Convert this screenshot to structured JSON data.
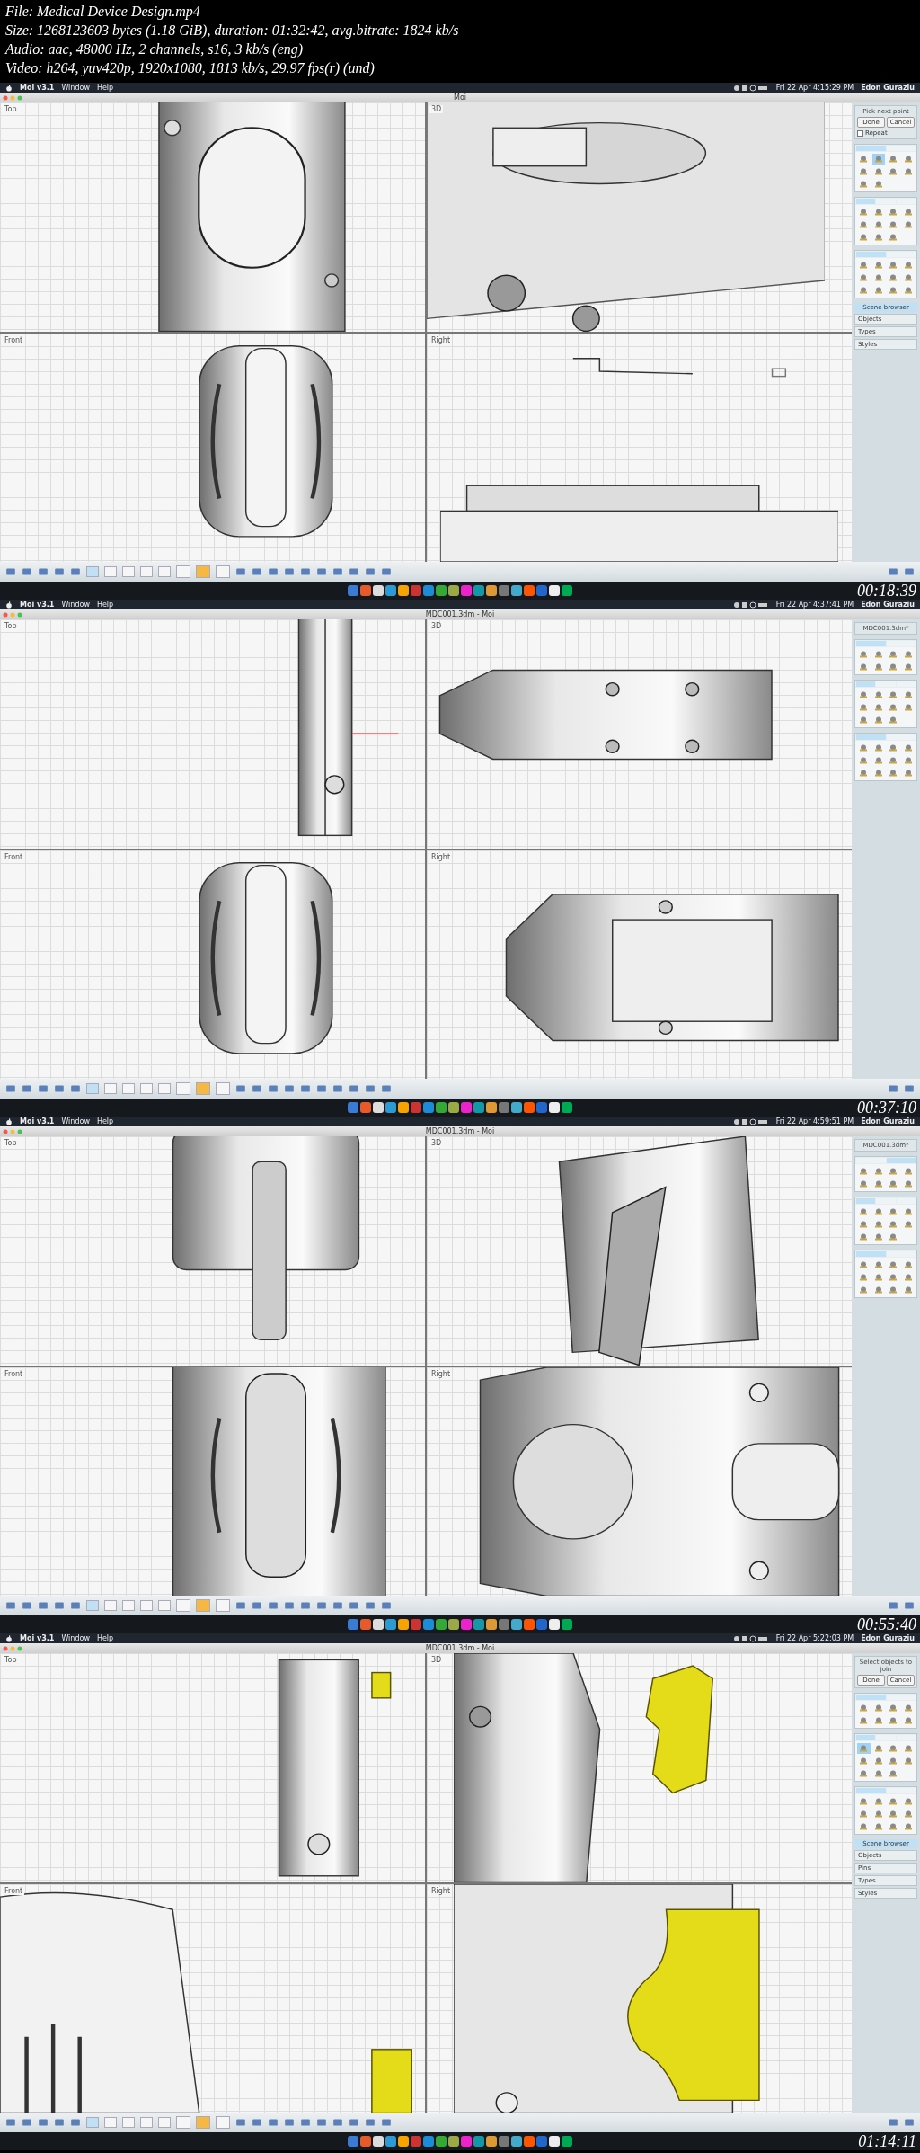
{
  "file_info": [
    "File: Medical Device Design.mp4",
    "Size: 1268123603 bytes (1.18 GiB), duration: 01:32:42, avg.bitrate: 1824 kb/s",
    "Audio: aac, 48000 Hz, 2 channels, s16, 3 kb/s (eng)",
    "Video: h264, yuv420p, 1920x1080, 1813 kb/s, 29.97 fps(r) (und)"
  ],
  "frames": [
    {
      "timestamp": "00:18:39",
      "menubar": {
        "app": "Moi v3.1",
        "menus": [
          "Window",
          "Help"
        ],
        "clock": "Fri 22 Apr 4:15:29 PM",
        "user": "Edon Guraziu"
      },
      "window_title": "Moi",
      "viewports": [
        {
          "label": "Top",
          "kind": "slot"
        },
        {
          "label": "3D",
          "kind": "disc"
        },
        {
          "label": "Front",
          "kind": "wheel"
        },
        {
          "label": "Right",
          "kind": "line"
        }
      ],
      "sidebar": {
        "prompt": "Pick next point",
        "buttons": [
          "Done",
          "Cancel"
        ],
        "repeat": {
          "label": "Repeat",
          "checked": false
        },
        "scene": {
          "title": "Scene browser",
          "items": [
            "Objects",
            "Types",
            "Styles"
          ]
        },
        "panels": [
          {
            "tabs": [
              {
                "selected": true
              },
              {
                "selected": false
              }
            ],
            "tools": [
              {
                "selected": false
              },
              {
                "selected": true
              },
              {
                "selected": false
              },
              {
                "selected": false
              },
              {
                "selected": false
              },
              {
                "selected": false
              },
              {
                "selected": false
              },
              {
                "selected": false
              },
              {
                "selected": false
              },
              {
                "selected": false
              }
            ]
          },
          {
            "tabs": [
              {
                "selected": true
              },
              {
                "selected": false
              },
              {
                "selected": false
              }
            ],
            "tools": [
              {
                "selected": false
              },
              {
                "selected": false
              },
              {
                "selected": false
              },
              {
                "selected": false
              },
              {
                "selected": false
              },
              {
                "selected": false
              },
              {
                "selected": false
              },
              {
                "selected": false
              },
              {
                "selected": false
              },
              {
                "selected": false
              },
              {
                "selected": false
              }
            ]
          },
          {
            "tabs": [
              {
                "selected": true
              },
              {
                "selected": false
              }
            ],
            "tools": [
              {
                "selected": false
              },
              {
                "selected": false
              },
              {
                "selected": false
              },
              {
                "selected": false
              },
              {
                "selected": false
              },
              {
                "selected": false
              },
              {
                "selected": false
              },
              {
                "selected": false
              },
              {
                "selected": false
              },
              {
                "selected": false
              },
              {
                "selected": false
              },
              {
                "selected": false
              }
            ]
          }
        ]
      },
      "toolbar": [
        {
          "kind": "tool"
        },
        {
          "kind": "tool"
        },
        {
          "kind": "tool"
        },
        {
          "kind": "tool"
        },
        {
          "kind": "tool"
        },
        {
          "kind": "view",
          "selected": true
        },
        {
          "kind": "view",
          "selected": false
        },
        {
          "kind": "view",
          "selected": false
        },
        {
          "kind": "view",
          "selected": false
        },
        {
          "kind": "view",
          "selected": false
        },
        {
          "kind": "snap",
          "on": false
        },
        {
          "kind": "snap",
          "on": true
        },
        {
          "kind": "snap",
          "on": false
        },
        {
          "kind": "tool"
        },
        {
          "kind": "tool"
        },
        {
          "kind": "tool"
        },
        {
          "kind": "tool"
        },
        {
          "kind": "tool"
        },
        {
          "kind": "tool"
        },
        {
          "kind": "tool"
        },
        {
          "kind": "tool"
        },
        {
          "kind": "tool"
        },
        {
          "kind": "tool"
        },
        {
          "kind": "end"
        },
        {
          "kind": "end"
        }
      ]
    },
    {
      "timestamp": "00:37:10",
      "menubar": {
        "app": "Moi v3.1",
        "menus": [
          "Window",
          "Help"
        ],
        "clock": "Fri 22 Apr 4:37:41 PM",
        "user": "Edon Guraziu"
      },
      "window_title": "MDC001.3dm - Moi",
      "viewports": [
        {
          "label": "Top",
          "kind": "probe-top"
        },
        {
          "label": "3D",
          "kind": "probe-3d"
        },
        {
          "label": "Front",
          "kind": "wheel"
        },
        {
          "label": "Right",
          "kind": "probe-side"
        }
      ],
      "sidebar": {
        "prompt": "MDC001.3dm*",
        "panels": [
          {
            "tabs": [
              {
                "selected": true
              },
              {
                "selected": false
              }
            ],
            "tools": [
              {
                "selected": false
              },
              {
                "selected": false
              },
              {
                "selected": false
              },
              {
                "selected": false
              },
              {
                "selected": false
              },
              {
                "selected": false
              },
              {
                "selected": false
              },
              {
                "selected": false
              }
            ]
          },
          {
            "tabs": [
              {
                "selected": true
              },
              {
                "selected": false
              },
              {
                "selected": false
              }
            ],
            "tools": [
              {
                "selected": false
              },
              {
                "selected": false
              },
              {
                "selected": false
              },
              {
                "selected": false
              },
              {
                "selected": false
              },
              {
                "selected": false
              },
              {
                "selected": false
              },
              {
                "selected": false
              },
              {
                "selected": false
              },
              {
                "selected": false
              },
              {
                "selected": false
              }
            ]
          },
          {
            "tabs": [
              {
                "selected": true
              },
              {
                "selected": false
              }
            ],
            "tools": [
              {
                "selected": false
              },
              {
                "selected": false
              },
              {
                "selected": false
              },
              {
                "selected": false
              },
              {
                "selected": false
              },
              {
                "selected": false
              },
              {
                "selected": false
              },
              {
                "selected": false
              },
              {
                "selected": false
              },
              {
                "selected": false
              },
              {
                "selected": false
              },
              {
                "selected": false
              }
            ]
          }
        ]
      },
      "toolbar": [
        {
          "kind": "tool"
        },
        {
          "kind": "tool"
        },
        {
          "kind": "tool"
        },
        {
          "kind": "tool"
        },
        {
          "kind": "tool"
        },
        {
          "kind": "view",
          "selected": true
        },
        {
          "kind": "view",
          "selected": false
        },
        {
          "kind": "view",
          "selected": false
        },
        {
          "kind": "view",
          "selected": false
        },
        {
          "kind": "view",
          "selected": false
        },
        {
          "kind": "snap",
          "on": false
        },
        {
          "kind": "snap",
          "on": true
        },
        {
          "kind": "snap",
          "on": false
        },
        {
          "kind": "tool"
        },
        {
          "kind": "tool"
        },
        {
          "kind": "tool"
        },
        {
          "kind": "tool"
        },
        {
          "kind": "tool"
        },
        {
          "kind": "tool"
        },
        {
          "kind": "tool"
        },
        {
          "kind": "tool"
        },
        {
          "kind": "tool"
        },
        {
          "kind": "tool"
        },
        {
          "kind": "end"
        },
        {
          "kind": "end"
        }
      ]
    },
    {
      "timestamp": "00:55:40",
      "menubar": {
        "app": "Moi v3.1",
        "menus": [
          "Window",
          "Help"
        ],
        "clock": "Fri 22 Apr 4:59:51 PM",
        "user": "Edon Guraziu"
      },
      "window_title": "MDC001.3dm - Moi",
      "viewports": [
        {
          "label": "Top",
          "kind": "mesh-top"
        },
        {
          "label": "3D",
          "kind": "mesh-3d"
        },
        {
          "label": "Front",
          "kind": "mesh-wheel"
        },
        {
          "label": "Right",
          "kind": "probe-head"
        }
      ],
      "sidebar": {
        "prompt": "MDC001.3dm*",
        "panels": [
          {
            "tabs": [
              {
                "selected": false
              },
              {
                "selected": true
              }
            ],
            "tools": [
              {
                "selected": false
              },
              {
                "selected": false
              },
              {
                "selected": false
              },
              {
                "selected": false
              },
              {
                "selected": false
              },
              {
                "selected": false
              },
              {
                "selected": false
              },
              {
                "selected": false
              }
            ]
          },
          {
            "tabs": [
              {
                "selected": true
              },
              {
                "selected": false
              },
              {
                "selected": false
              }
            ],
            "tools": [
              {
                "selected": false
              },
              {
                "selected": false
              },
              {
                "selected": false
              },
              {
                "selected": false
              },
              {
                "selected": false
              },
              {
                "selected": false
              },
              {
                "selected": false
              },
              {
                "selected": false
              },
              {
                "selected": false
              },
              {
                "selected": false
              },
              {
                "selected": false
              }
            ]
          },
          {
            "tabs": [
              {
                "selected": true
              },
              {
                "selected": false
              }
            ],
            "tools": [
              {
                "selected": false
              },
              {
                "selected": false
              },
              {
                "selected": false
              },
              {
                "selected": false
              },
              {
                "selected": false
              },
              {
                "selected": false
              },
              {
                "selected": false
              },
              {
                "selected": false
              },
              {
                "selected": false
              },
              {
                "selected": false
              },
              {
                "selected": false
              },
              {
                "selected": false
              }
            ]
          }
        ]
      },
      "toolbar": [
        {
          "kind": "tool"
        },
        {
          "kind": "tool"
        },
        {
          "kind": "tool"
        },
        {
          "kind": "tool"
        },
        {
          "kind": "tool"
        },
        {
          "kind": "view",
          "selected": true
        },
        {
          "kind": "view",
          "selected": false
        },
        {
          "kind": "view",
          "selected": false
        },
        {
          "kind": "view",
          "selected": false
        },
        {
          "kind": "view",
          "selected": false
        },
        {
          "kind": "snap",
          "on": false
        },
        {
          "kind": "snap",
          "on": true
        },
        {
          "kind": "snap",
          "on": false
        },
        {
          "kind": "tool"
        },
        {
          "kind": "tool"
        },
        {
          "kind": "tool"
        },
        {
          "kind": "tool"
        },
        {
          "kind": "tool"
        },
        {
          "kind": "tool"
        },
        {
          "kind": "tool"
        },
        {
          "kind": "tool"
        },
        {
          "kind": "tool"
        },
        {
          "kind": "tool"
        },
        {
          "kind": "end"
        },
        {
          "kind": "end"
        }
      ]
    },
    {
      "timestamp": "01:14:11",
      "menubar": {
        "app": "Moi v3.1",
        "menus": [
          "Window",
          "Help"
        ],
        "clock": "Fri 22 Apr 5:22:03 PM",
        "user": "Edon Guraziu"
      },
      "window_title": "MDC001.3dm - Moi",
      "viewports": [
        {
          "label": "Top",
          "kind": "probe-top-yellow"
        },
        {
          "label": "3D",
          "kind": "block-yellow"
        },
        {
          "label": "Front",
          "kind": "closeup-yellow"
        },
        {
          "label": "Right",
          "kind": "tab-yellow"
        }
      ],
      "sidebar": {
        "prompt": "Select objects to join",
        "buttons": [
          "Done",
          "Cancel"
        ],
        "scene": {
          "title": "Scene browser",
          "items": [
            "Objects",
            "Pins",
            "Types",
            "Styles"
          ]
        },
        "panels": [
          {
            "tabs": [
              {
                "selected": true
              },
              {
                "selected": false
              }
            ],
            "tools": [
              {
                "selected": false
              },
              {
                "selected": false
              },
              {
                "selected": false
              },
              {
                "selected": false
              },
              {
                "selected": false
              },
              {
                "selected": false
              },
              {
                "selected": false
              },
              {
                "selected": false
              }
            ]
          },
          {
            "tabs": [
              {
                "selected": true
              },
              {
                "selected": false
              },
              {
                "selected": false
              }
            ],
            "tools": [
              {
                "selected": true
              },
              {
                "selected": false
              },
              {
                "selected": false
              },
              {
                "selected": false
              },
              {
                "selected": false
              },
              {
                "selected": false
              },
              {
                "selected": false
              },
              {
                "selected": false
              },
              {
                "selected": false
              },
              {
                "selected": false
              },
              {
                "selected": false
              }
            ]
          },
          {
            "tabs": [
              {
                "selected": true
              },
              {
                "selected": false
              }
            ],
            "tools": [
              {
                "selected": false
              },
              {
                "selected": false
              },
              {
                "selected": false
              },
              {
                "selected": false
              },
              {
                "selected": false
              },
              {
                "selected": false
              },
              {
                "selected": false
              },
              {
                "selected": false
              },
              {
                "selected": false
              },
              {
                "selected": false
              },
              {
                "selected": false
              },
              {
                "selected": false
              }
            ]
          }
        ]
      },
      "toolbar": [
        {
          "kind": "tool"
        },
        {
          "kind": "tool"
        },
        {
          "kind": "tool"
        },
        {
          "kind": "tool"
        },
        {
          "kind": "tool"
        },
        {
          "kind": "view",
          "selected": true
        },
        {
          "kind": "view",
          "selected": false
        },
        {
          "kind": "view",
          "selected": false
        },
        {
          "kind": "view",
          "selected": false
        },
        {
          "kind": "view",
          "selected": false
        },
        {
          "kind": "snap",
          "on": false
        },
        {
          "kind": "snap",
          "on": true
        },
        {
          "kind": "snap",
          "on": false
        },
        {
          "kind": "tool"
        },
        {
          "kind": "tool"
        },
        {
          "kind": "tool"
        },
        {
          "kind": "tool"
        },
        {
          "kind": "tool"
        },
        {
          "kind": "tool"
        },
        {
          "kind": "tool"
        },
        {
          "kind": "tool"
        },
        {
          "kind": "tool"
        },
        {
          "kind": "tool"
        },
        {
          "kind": "end"
        },
        {
          "kind": "end"
        }
      ]
    }
  ]
}
